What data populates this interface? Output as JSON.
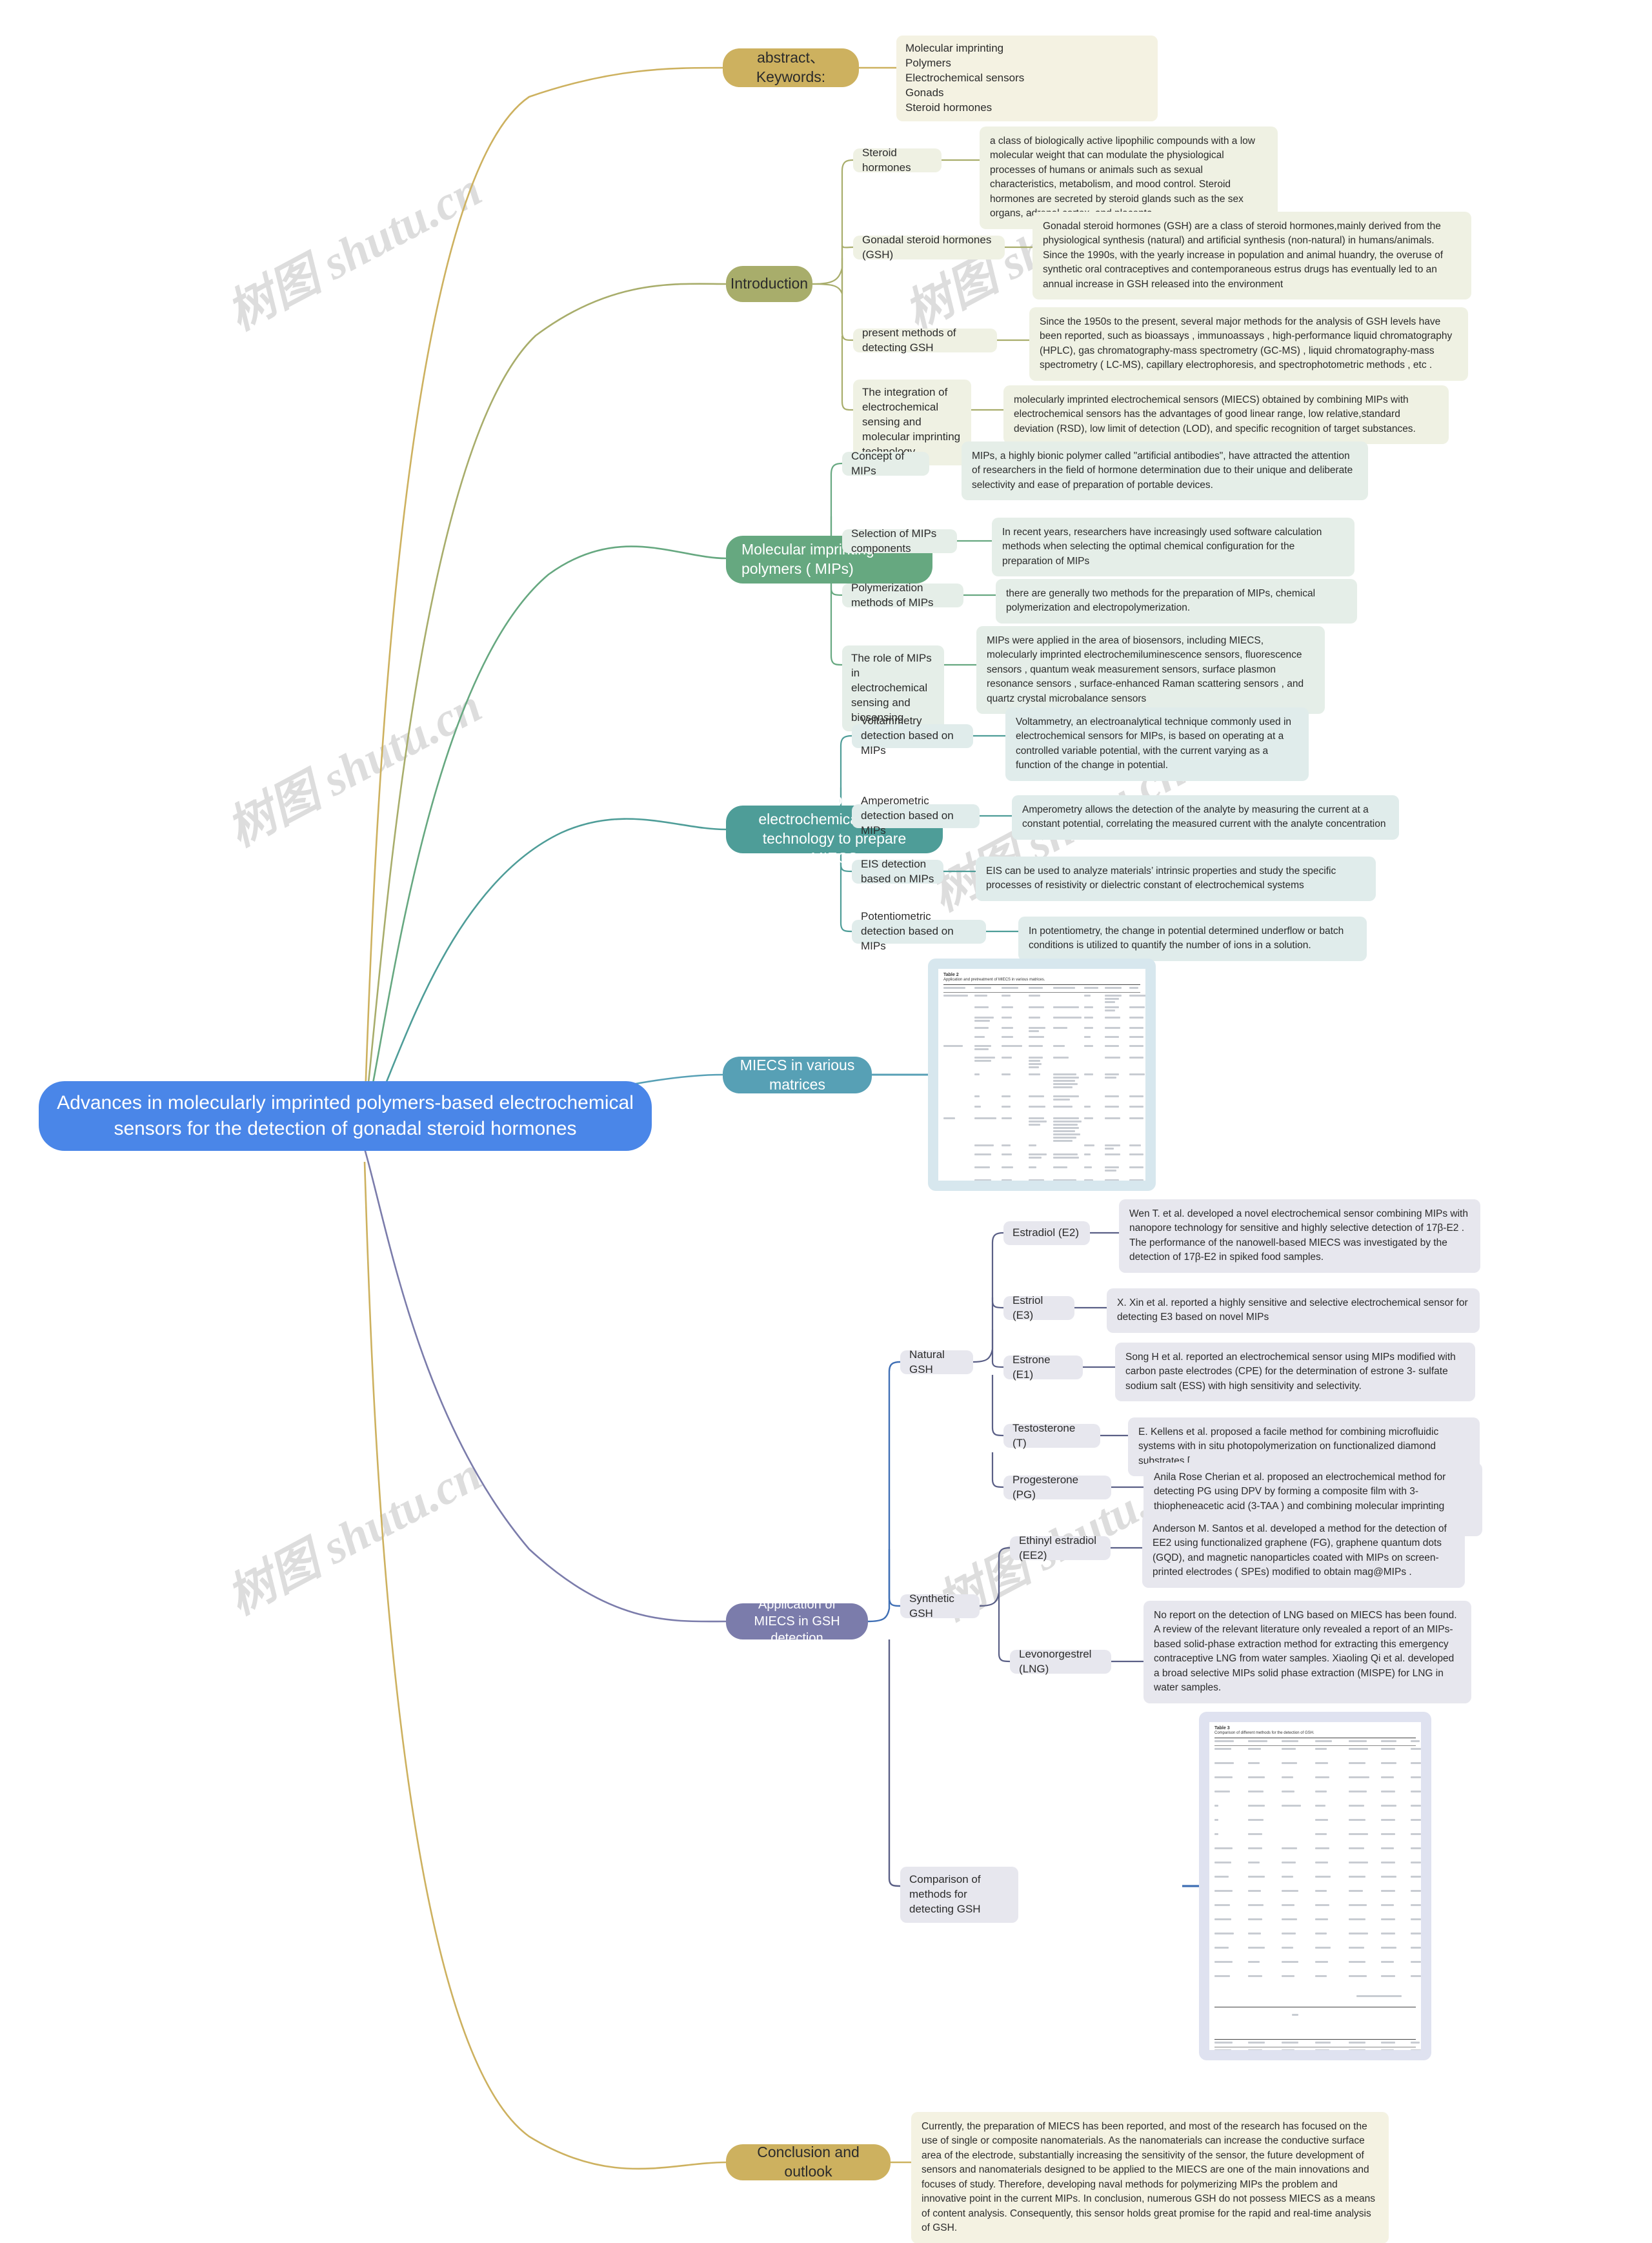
{
  "root": {
    "title": "Advances in molecularly imprinted polymers-based electrochemical sensors for the detection of gonadal steroid hormones"
  },
  "watermarks": [
    "树图 shutu.cn",
    "树图 shutu.cn",
    "树图 shutu.cn",
    "树图 shutu.cn",
    "树图 shutu.cn",
    "树图 shutu.cn",
    "shutu.cn"
  ],
  "branches": {
    "abstract": {
      "label": "abstract、Keywords:",
      "keywords": "Molecular imprinting\nPolymers\nElectrochemical sensors\nGonads\nSteroid hormones"
    },
    "introduction": {
      "label": "Introduction",
      "items": [
        {
          "label": "Steroid hormones",
          "text": " a class of biologically active lipophilic compounds with a low molecular weight that can modulate the physiological processes of humans or animals such as sexual characteristics, metabolism, and mood control.  Steroid hormones are secreted by steroid glands such as the sex organs, adrenal cortex, and placenta."
        },
        {
          "label": "Gonadal steroid hormones (GSH)",
          "text": "Gonadal steroid hormones (GSH) are a class of steroid hormones,mainly derived from the physiological synthesis (natural) and artificial synthesis (non-natural) in humans/animals. Since the 1990s, with the yearly increase in population and animal huandry, the overuse of synthetic oral contraceptives and contemporaneous estrus drugs has eventually led to an annual increase in GSH released into the environment"
        },
        {
          "label": "present methods of detecting GSH",
          "text": "Since the 1950s to the present, several major methods for the analysis of GSH levels have been reported, such as bioassays , immunoassays , high-performance liquid chromatography (HPLC), gas chromatography-mass spectrometry (GC-MS) , liquid chromatography-mass spectrometry ( LC-MS), capillary electrophoresis, and spectrophotometric methods , etc ."
        },
        {
          "label": "The integration of electrochemical sensing and molecular imprinting technology",
          "text": "  molecularly imprinted electrochemical sensors (MIECS) obtained by combining MIPs with electrochemical sensors has the advantages of good linear range, low relative,standard deviation (RSD), low limit of detection (LOD), and specific recognition of target substances."
        }
      ]
    },
    "mips": {
      "label": "Molecular imprinting polymers ( MIPs)",
      "items": [
        {
          "label": "Concept of MIPs",
          "text": "MIPs, a highly bionic polymer called \"artificial antibodies\", have attracted the attention of researchers in the field of hormone determination due to their unique and deliberate selectivity and ease of preparation of portable devices."
        },
        {
          "label": "Selection of MIPs components",
          "text": " In recent years, researchers have increasingly used software calculation methods when selecting the optimal chemical configuration for the preparation of MIPs"
        },
        {
          "label": "Polymerization methods of MIPs",
          "text": "there are generally two methods for the preparation of MIPs, chemical polymerization and electropolymerization."
        },
        {
          "label": "The role of MIPs in electrochemical sensing and biosensing",
          "text": "MIPs were applied in the area of biosensors, including MIECS, molecularly imprinted electrochemiluminescence sensors, fluorescence sensors , quantum weak measurement sensors, surface plasmon resonance sensors , surface-enhanced Raman scattering sensors , and quartz crystal microbalance sensors"
        }
      ]
    },
    "miecs_prep": {
      "label": "MIPs combined with electrochemical sensor technology to prepare MIECS",
      "items": [
        {
          "label": "Voltammetry detection based on MIPs",
          "text": "Voltammetry, an electroanalytical technique commonly used in electrochemical sensors for MIPs, is based on operating at a controlled variable potential, with the current varying as a function of the change in potential."
        },
        {
          "label": "Amperometric detection based on MIPs",
          "text": "Amperometry allows the detection of the analyte by measuring the current at a constant potential, correlating the measured current with  the analyte concentration"
        },
        {
          "label": "EIS detection based on MIPs",
          "text": "EIS can be used to analyze materials’   intrinsic properties and study the specific processes of resistivity or dielectric constant of electrochemical systems"
        },
        {
          "label": "Potentiometric detection based on MIPs",
          "text": "In potentiometry, the change in potential determined underflow or batch conditions is utilized to quantify the number of ions in a solution."
        }
      ]
    },
    "matrices": {
      "label": "MIECS in various matrices",
      "table_title": "Table 2",
      "table_caption": "Application and pretreatment of MIECS in various matrices."
    },
    "application": {
      "label": "Application of MIECS in GSH detection",
      "groups": [
        {
          "label": "Natural GSH",
          "items": [
            {
              "label": "Estradiol (E2)",
              "text": "Wen T. et al. developed a novel electrochemical sensor combining MIPs with nanopore technology for sensitive and highly selective detection of 17β-E2 . The performance of the nanowell-based MIECS was investigated by the detection of 17β-E2 in spiked food samples."
            },
            {
              "label": "Estriol (E3)",
              "text": "X. Xin et al. reported a highly sensitive and selective electrochemical sensor for detecting E3 based on novel MIPs"
            },
            {
              "label": "Estrone (E1)",
              "text": "Song H et al. reported an electrochemical sensor using MIPs modified with carbon paste electrodes (CPE) for the determination of estrone 3- sulfate sodium salt (ESS) with high sensitivity and selectivity."
            },
            {
              "label": "Testosterone (T)",
              "text": "E. Kellens et al. proposed a facile method for combining microfluidic systems with in situ photopolymerization on functionalized diamond substrates ["
            },
            {
              "label": "Progesterone (PG)",
              "text": "Anila Rose Cherian et al. proposed an electrochemical method for detecting PG using DPV by forming a composite film with 3-thiopheneacetic acid (3-TAA ) and combining molecular imprinting technology"
            }
          ]
        },
        {
          "label": "Synthetic GSH",
          "items": [
            {
              "label": "Ethinyl estradiol (EE2)",
              "text": "Anderson M. Santos et al. developed a method for the detection of EE2 using functionalized graphene (FG), graphene quantum dots (GQD), and magnetic nanoparticles coated with MIPs on screen-printed electrodes ( SPEs) modified to obtain mag@MIPs ."
            },
            {
              "label": "Levonorgestrel (LNG)",
              "text": "No report on the detection of LNG based on MIECS has been found. A review of the relevant literature only revealed a report of an MIPs-based solid-phase extraction method for extracting this emergency contraceptive LNG from water samples. Xiaoling Qi et al. developed a broad selective MIPs solid phase extraction (MISPE) for LNG in water samples."
            }
          ]
        },
        {
          "label": "Comparison of methods for detecting GSH",
          "table_title": "Table 3",
          "table_caption": "Comparison of different methods for the detection of GSH."
        }
      ]
    },
    "conclusion": {
      "label": "Conclusion and outlook",
      "text": " Currently, the preparation of MIECS has been reported, and most of the research has focused on the use of single or composite nanomaterials. As the nanomaterials can increase the conductive surface area of the electrode, substantially increasing the sensitivity of the sensor, the future development of sensors and nanomaterials designed to be applied to the MIECS are one of the main innovations and focuses of study. Therefore, developing naval methods for polymerizing MIPs the problem and innovative point in the current MIPs. In conclusion, numerous GSH do not possess MIECS as a means of content analysis. Consequently, this sensor holds great promise for the rapid and real-time analysis of GSH."
    }
  },
  "colors": {
    "root": "#4a86e8",
    "gold": "#cdb15f",
    "olive": "#a8ad6b",
    "green": "#66a880",
    "teal": "#4e9d98",
    "cyan": "#57a0b5",
    "purple": "#7b7cab"
  }
}
